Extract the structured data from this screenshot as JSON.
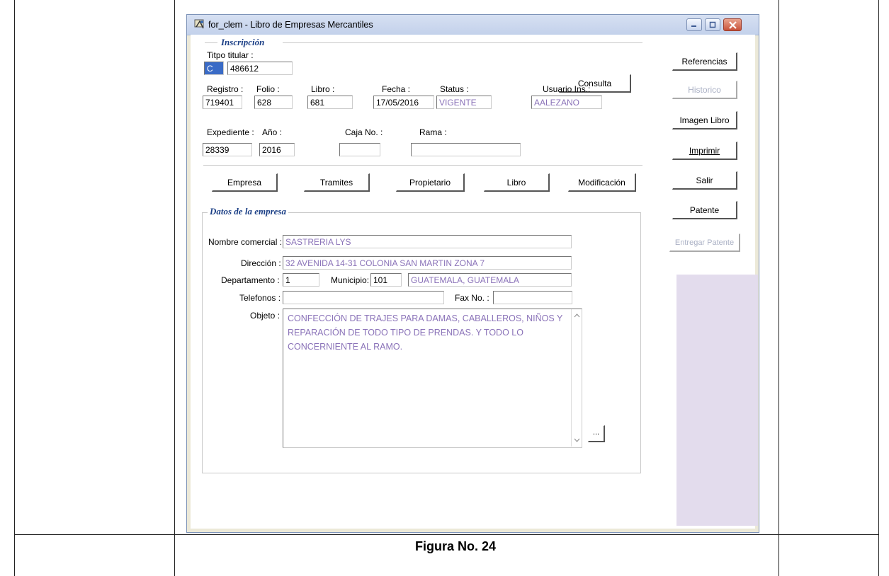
{
  "window": {
    "title": "for_clem - Libro de Empresas Mercantiles"
  },
  "inscripcion": {
    "group_title": "Inscripción",
    "tipo_titular_label": "Titpo titular :",
    "tipo_titular_code": "C",
    "tipo_titular_value": "486612",
    "consulta_label": "Consulta",
    "registro_label": "Registro :",
    "registro_value": "719401",
    "folio_label": "Folio :",
    "folio_value": "628",
    "libro_label": "Libro :",
    "libro_value": "681",
    "fecha_label": "Fecha :",
    "fecha_value": "17/05/2016",
    "status_label": "Status :",
    "status_value": "VIGENTE",
    "usuario_label": "Usuario Ins.:",
    "usuario_value": "AALEZANO",
    "expediente_label": "Expediente :",
    "expediente_value": "28339",
    "anio_label": "Año :",
    "anio_value": "2016",
    "caja_label": "Caja No. :",
    "caja_value": "",
    "rama_label": "Rama :",
    "rama_value": ""
  },
  "tabs": {
    "empresa": "Empresa",
    "tramites": "Tramites",
    "propietario": "Propietario",
    "libro": "Libro",
    "modificacion": "Modificación"
  },
  "empresa": {
    "group_title": "Datos de la empresa",
    "nombre_label": "Nombre comercial :",
    "nombre_value": "SASTRERIA LYS",
    "direccion_label": "Dirección :",
    "direccion_value": "32  AVENIDA  14-31  COLONIA  SAN  MARTIN ZONA 7",
    "departamento_label": "Departamento :",
    "departamento_value": "1",
    "municipio_label": "Municipio:",
    "municipio_code": "101",
    "municipio_value": "GUATEMALA, GUATEMALA",
    "telefonos_label": "Telefonos :",
    "telefonos_value": "",
    "fax_label": "Fax No. :",
    "fax_value": "",
    "objeto_label": "Objeto :",
    "objeto_line1": "CONFECCIÓN DE TRAJES PARA DAMAS, CABALLEROS, NIÑOS Y",
    "objeto_line2": "REPARACIÓN DE TODO TIPO DE PRENDAS. Y TODO LO",
    "objeto_line3": "CONCERNIENTE AL RAMO.",
    "more_label": "..."
  },
  "side_buttons": {
    "referencias": "Referencias",
    "historico": "Historico",
    "imagen_libro": "Imagen Libro",
    "imprimir": "Imprimir",
    "salir": "Salir",
    "patente": "Patente",
    "entregar_patente": "Entregar Patente"
  },
  "caption": "Figura No. 24",
  "colors": {
    "value_text": "#8a72b8",
    "group_title": "#1b3f86",
    "side_panel": "#e3dced"
  }
}
